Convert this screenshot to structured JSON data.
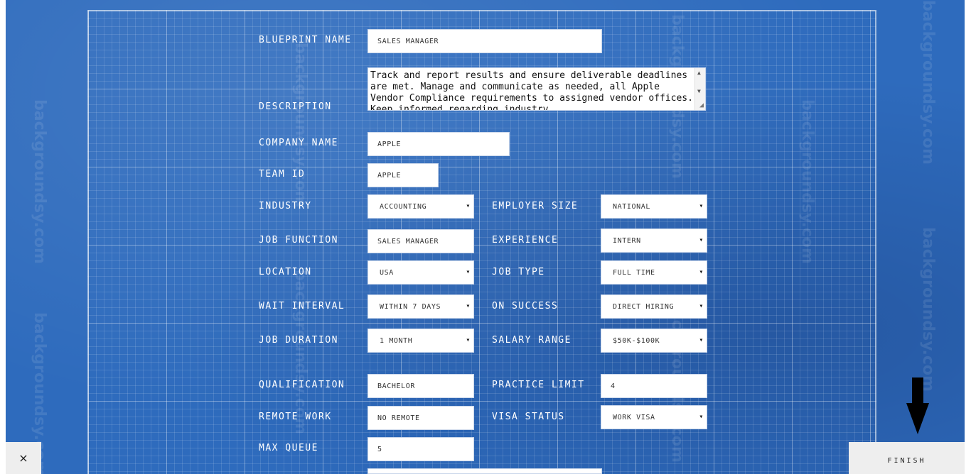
{
  "form": {
    "blueprint_name": {
      "label": "BLUEPRINT NAME",
      "value": "SALES MANAGER"
    },
    "description": {
      "label": "DESCRIPTION",
      "value": "Track and report results and ensure deliverable deadlines are met. Manage and communicate as needed, all Apple Vendor Compliance requirements to assigned vendor offices. Keep informed regarding industry"
    },
    "company_name": {
      "label": "COMPANY NAME",
      "value": "APPLE"
    },
    "team_id": {
      "label": "TEAM ID",
      "value": "APPLE"
    },
    "industry": {
      "label": "INDUSTRY",
      "value": "ACCOUNTING"
    },
    "employer_size": {
      "label": "EMPLOYER SIZE",
      "value": "NATIONAL"
    },
    "job_function": {
      "label": "JOB FUNCTION",
      "value": "SALES MANAGER"
    },
    "experience": {
      "label": "EXPERIENCE",
      "value": "INTERN"
    },
    "location": {
      "label": "LOCATION",
      "value": "USA"
    },
    "job_type": {
      "label": "JOB TYPE",
      "value": "FULL TIME"
    },
    "wait_interval": {
      "label": "WAIT INTERVAL",
      "value": "WITHIN 7 DAYS"
    },
    "on_success": {
      "label": "ON SUCCESS",
      "value": "DIRECT HIRING"
    },
    "job_duration": {
      "label": "JOB DURATION",
      "value": "1 MONTH"
    },
    "salary_range": {
      "label": "SALARY RANGE",
      "value": "$50K-$100K"
    },
    "qualification": {
      "label": "QUALIFICATION",
      "value": "BACHELOR"
    },
    "practice_limit": {
      "label": "PRACTICE LIMIT",
      "value": "4"
    },
    "remote_work": {
      "label": "REMOTE WORK",
      "value": "NO REMOTE"
    },
    "visa_status": {
      "label": "VISA STATUS",
      "value": "WORK VISA"
    },
    "max_queue": {
      "label": "MAX QUEUE",
      "value": "5"
    }
  },
  "buttons": {
    "close": "×",
    "finish": "FINISH"
  },
  "icons": {
    "caret": "▾",
    "close": "close-icon",
    "arrow": "arrow-down-icon"
  },
  "watermark": "backgroundsy.com",
  "colors": {
    "background": "#2e6bbd",
    "grid": "#ffffff",
    "button": "#eeeeee"
  }
}
